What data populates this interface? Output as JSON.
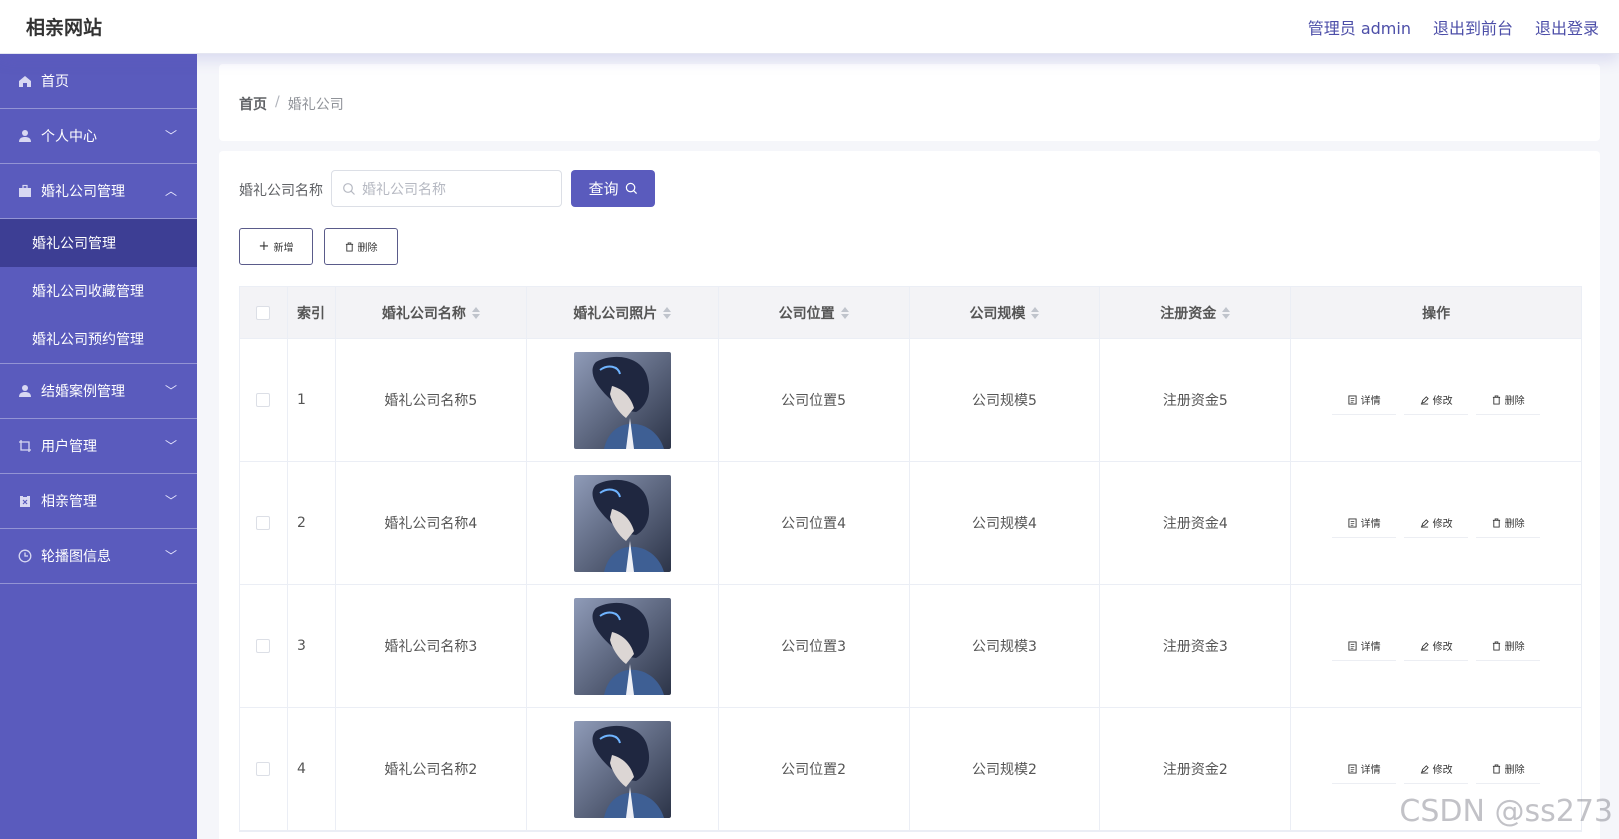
{
  "header": {
    "site_title": "相亲网站",
    "admin_label": "管理员 admin",
    "back_front": "退出到前台",
    "logout": "退出登录"
  },
  "sidebar": {
    "home": "首页",
    "personal": "个人中心",
    "wedding_mgmt": "婚礼公司管理",
    "sub": [
      "婚礼公司管理",
      "婚礼公司收藏管理",
      "婚礼公司预约管理"
    ],
    "case_mgmt": "结婚案例管理",
    "user_mgmt": "用户管理",
    "date_mgmt": "相亲管理",
    "carousel": "轮播图信息"
  },
  "breadcrumb": {
    "home": "首页",
    "sep": "/",
    "current": "婚礼公司"
  },
  "search": {
    "label": "婚礼公司名称",
    "placeholder": "婚礼公司名称",
    "button": "查询"
  },
  "actions": {
    "add": "新增",
    "delete": "删除"
  },
  "table": {
    "headers": [
      "索引",
      "婚礼公司名称",
      "婚礼公司照片",
      "公司位置",
      "公司规模",
      "注册资金",
      "操作"
    ],
    "op_labels": {
      "detail": "详情",
      "edit": "修改",
      "remove": "删除"
    },
    "rows": [
      {
        "idx": "1",
        "name": "婚礼公司名称5",
        "loc": "公司位置5",
        "scale": "公司规模5",
        "cap": "注册资金5"
      },
      {
        "idx": "2",
        "name": "婚礼公司名称4",
        "loc": "公司位置4",
        "scale": "公司规模4",
        "cap": "注册资金4"
      },
      {
        "idx": "3",
        "name": "婚礼公司名称3",
        "loc": "公司位置3",
        "scale": "公司规模3",
        "cap": "注册资金3"
      },
      {
        "idx": "4",
        "name": "婚礼公司名称2",
        "loc": "公司位置2",
        "scale": "公司规模2",
        "cap": "注册资金2"
      }
    ]
  },
  "watermark": "CSDN @ss273",
  "colors": {
    "primary": "#5a5bbd",
    "sidebar_active": "#3d3e94"
  }
}
